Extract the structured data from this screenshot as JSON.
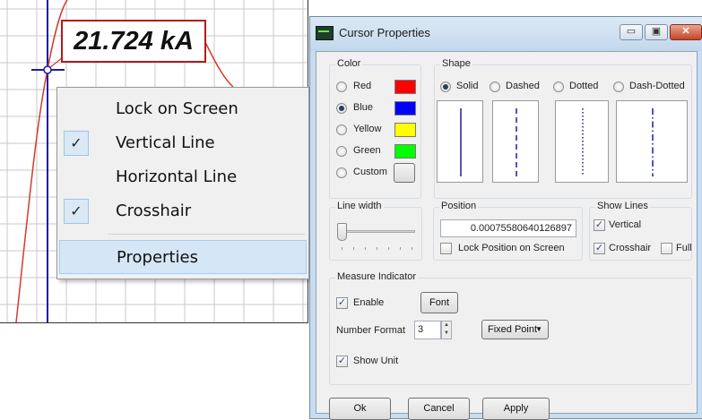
{
  "plot": {
    "measure_value": "21.724 kA"
  },
  "context_menu": {
    "items": [
      {
        "label": "Lock on Screen",
        "checked": false
      },
      {
        "label": "Vertical Line",
        "checked": true
      },
      {
        "label": "Horizontal Line",
        "checked": false
      },
      {
        "label": "Crosshair",
        "checked": true
      },
      {
        "label": "Properties",
        "checked": false,
        "highlighted": true
      }
    ],
    "check_glyph": "✓"
  },
  "dialog": {
    "title": "Cursor Properties",
    "title_buttons": {
      "minimize": "▭",
      "maximize": "▣",
      "close": "✕"
    },
    "color_group": {
      "title": "Color",
      "options": [
        {
          "label": "Red",
          "swatch": "#ff0000",
          "selected": false
        },
        {
          "label": "Blue",
          "swatch": "#0000ff",
          "selected": true
        },
        {
          "label": "Yellow",
          "swatch": "#ffff00",
          "selected": false
        },
        {
          "label": "Green",
          "swatch": "#00ff00",
          "selected": false
        },
        {
          "label": "Custom",
          "swatch": "#e9e9e9",
          "selected": false
        }
      ]
    },
    "shape_group": {
      "title": "Shape",
      "options": [
        {
          "label": "Solid",
          "selected": true
        },
        {
          "label": "Dashed",
          "selected": false
        },
        {
          "label": "Dotted",
          "selected": false
        },
        {
          "label": "Dash-Dotted",
          "selected": false
        }
      ]
    },
    "line_width": {
      "title": "Line width",
      "slider_value": 1
    },
    "position": {
      "title": "Position",
      "value": "0.00075580640126897",
      "lock_label": "Lock Position on Screen",
      "lock_checked": false
    },
    "show_lines": {
      "title": "Show Lines",
      "vertical_label": "Vertical",
      "vertical_checked": true,
      "crosshair_label": "Crosshair",
      "crosshair_checked": true,
      "full_label": "Full",
      "full_checked": false
    },
    "measure_indicator": {
      "title": "Measure Indicator",
      "enable_label": "Enable",
      "enable_checked": true,
      "font_button": "Font",
      "number_format_label": "Number Format",
      "number_format_value": "3",
      "format_select": "Fixed Point",
      "show_unit_label": "Show Unit",
      "show_unit_checked": true
    },
    "buttons": {
      "ok": "Ok",
      "cancel": "Cancel",
      "apply": "Apply"
    },
    "line_color": "#1a1aa8"
  },
  "colors": {
    "plot_grid": "#c8c8c8",
    "plot_curve": "#d53a2a",
    "cursor_line": "#1a1aa8",
    "measure_border": "#b41a1a",
    "menu_highlight": "#d5e6f7"
  }
}
